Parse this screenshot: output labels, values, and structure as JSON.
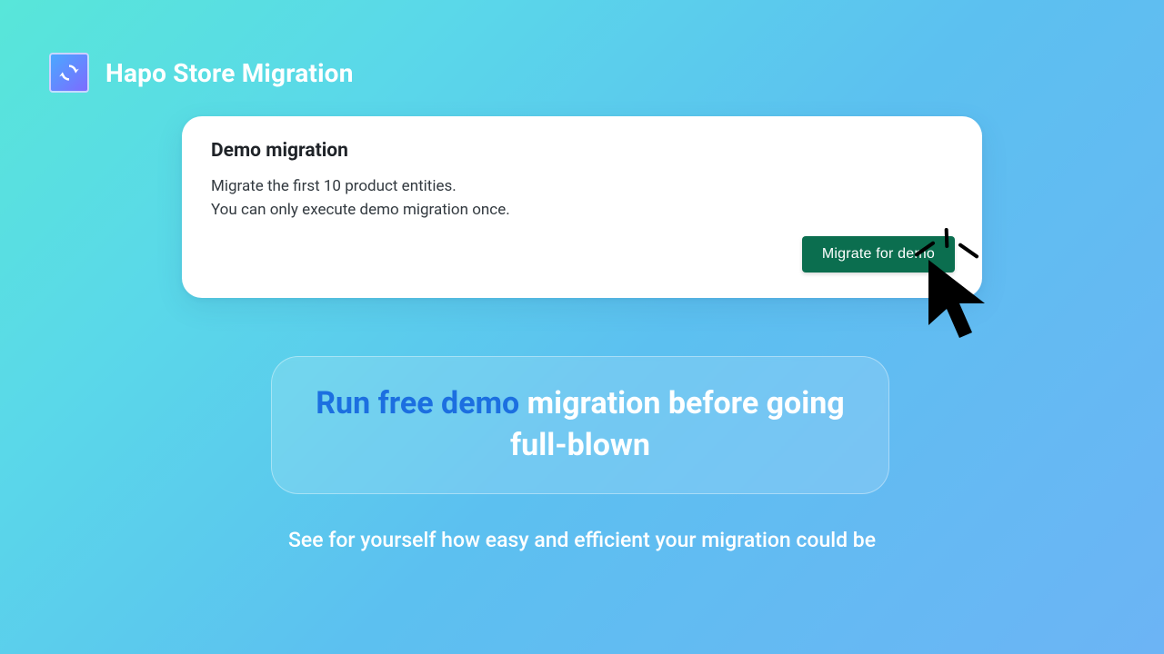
{
  "brand": {
    "title": "Hapo Store Migration",
    "icon": "refresh-sync-icon"
  },
  "card": {
    "title": "Demo migration",
    "line1": "Migrate the first 10 product entities.",
    "line2": "You can only execute demo migration once.",
    "button_label": "Migrate for demo"
  },
  "tagline": {
    "accent": "Run free demo",
    "rest": " migration before going full-blown"
  },
  "subtext": "See for yourself how easy and efficient your migration could be"
}
